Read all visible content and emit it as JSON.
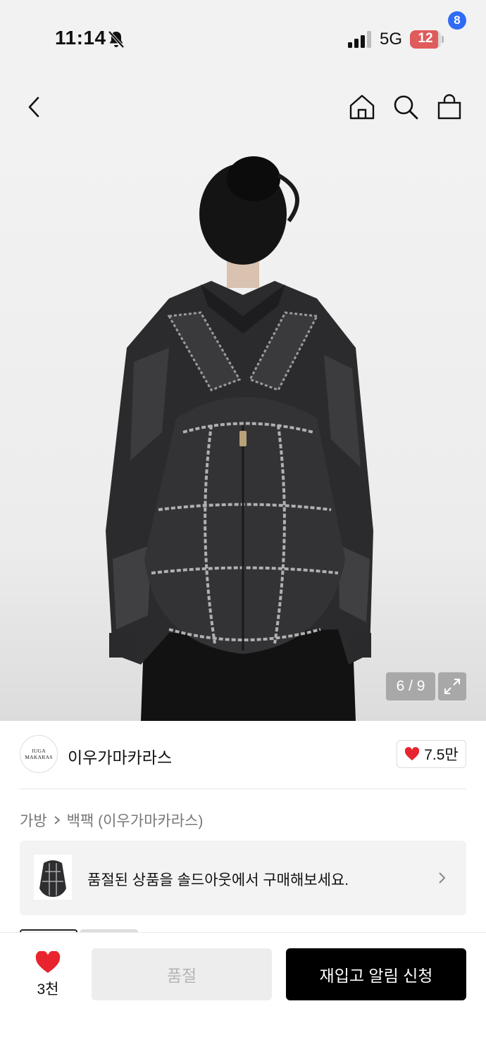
{
  "status_bar": {
    "time": "11:14",
    "network": "5G",
    "battery_level": "12",
    "icons": [
      "bell-off-icon",
      "signal-icon",
      "battery-icon"
    ]
  },
  "nav": {
    "icons": [
      "back-icon",
      "home-icon",
      "search-icon",
      "cart-icon"
    ],
    "cart_count": "8"
  },
  "gallery": {
    "indicator": "6 / 9",
    "expand_icon": "expand-icon"
  },
  "brand": {
    "logo_line1": "IUGA",
    "logo_line2": "MAKARAS",
    "name": "이우가마카라스",
    "likes": "7.5만"
  },
  "breadcrumb": {
    "category": "가방",
    "subcategory": "백팩 (이우가마카라스)"
  },
  "soldout_banner": {
    "text": "품절된 상품을 솔드아웃에서 구매해보세요."
  },
  "bottom_bar": {
    "wish_count": "3천",
    "soldout_label": "품절",
    "restock_label": "재입고 알림 신청"
  },
  "colors": {
    "accent_heart": "#e8242f",
    "cart_badge": "#2f6bf5",
    "primary_button": "#000000"
  }
}
